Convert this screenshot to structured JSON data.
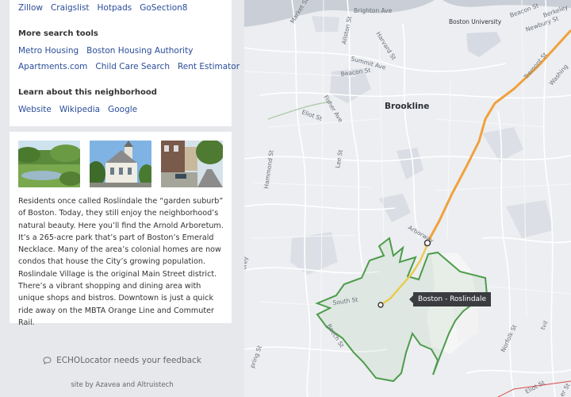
{
  "listing_links": [
    "Zillow",
    "Craigslist",
    "Hotpads",
    "GoSection8"
  ],
  "more_tools": {
    "title": "More search tools",
    "row1": [
      "Metro Housing",
      "Boston Housing Authority"
    ],
    "row2": [
      "Apartments.com",
      "Child Care Search",
      "Rent Estimator"
    ]
  },
  "learn": {
    "title": "Learn about this neighborhood",
    "links": [
      "Website",
      "Wikipedia",
      "Google"
    ]
  },
  "description": "Residents once called Roslindale the “garden suburb” of Boston. Today, they still enjoy the neighborhood’s natural beauty. Here you’ll find the Arnold Arboretum. It’s a 265-acre park that’s part of Boston’s Emerald Necklace. Many of the area’s colonial homes are now condos that house the City’s growing population. Roslindale Village is the original Main Street district. There’s a vibrant shopping and dining area with unique shops and bistros. Downtown is just a quick ride away on the MBTA Orange Line and Commuter Rail.",
  "feedback_label": "ECHOLocator needs your feedback",
  "credit": "site by Azavea and Altruistech",
  "map": {
    "tooltip": "Boston - Roslindale",
    "labels": {
      "brookline": "Brookline",
      "boston_university": "Boston University",
      "brighton_ave": "Brighton Ave",
      "market_st": "Market St",
      "beacon_st_ne": "Beacon St",
      "berkeley": "Berkeley",
      "newbury_st": "Newbury St",
      "allston_st": "Allston St",
      "harvard_st": "Harvard St",
      "summit_ave": "Summit Ave",
      "beacon_st": "Beacon St",
      "tremont_st": "Tremont St",
      "washington": "Washing",
      "fisher_ave": "Fisher Ave",
      "eliot_st": "Eliot St",
      "lee_st": "Lee St",
      "hammond_st": "Hammond St",
      "arborway": "Arborway",
      "corey": "orey",
      "south_st": "South St",
      "beech_st": "Beech St",
      "spring_st": "pring St",
      "norfolk_st": "Norfolk St",
      "eliot_st_se": "Eliot St",
      "tvil": "tvil",
      "er_st": "er St"
    },
    "colors": {
      "orange_line": "#f0a13c",
      "commuter_rail": "#e8cc4f",
      "boundary": "#4d9c4a",
      "water": "#c9ced7",
      "park": "#d8dce3"
    }
  }
}
